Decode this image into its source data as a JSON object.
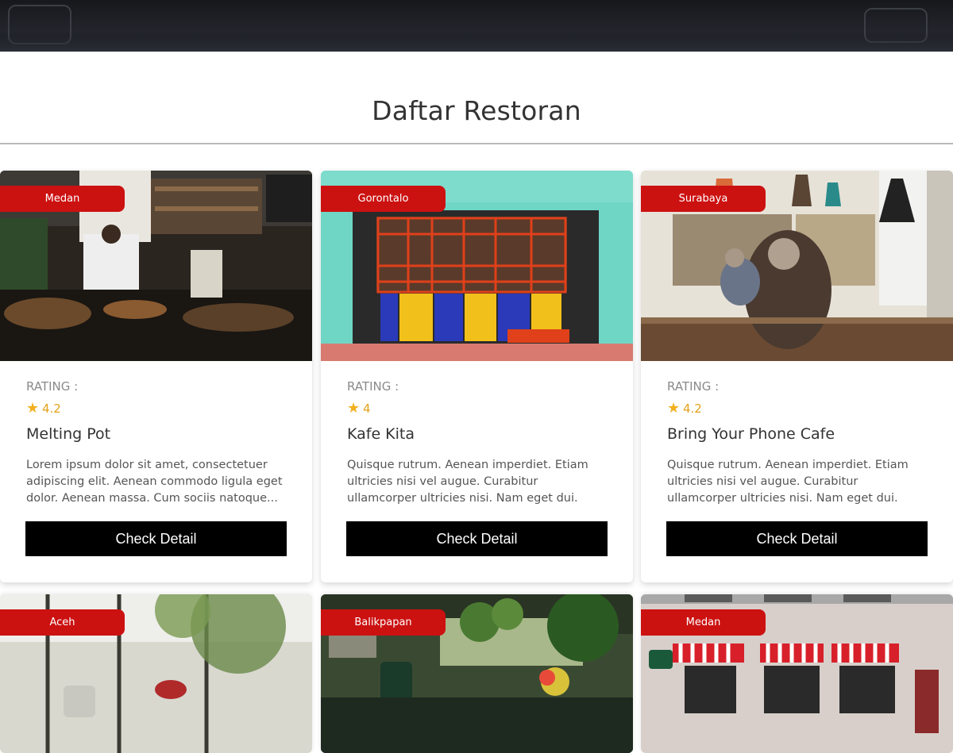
{
  "section": {
    "title": "Daftar Restoran"
  },
  "restaurants": [
    {
      "city": "Medan",
      "rating_label": "RATING :",
      "rating": "4.2",
      "name": "Melting Pot",
      "description": "Lorem ipsum dolor sit amet, consectetuer adipiscing elit. Aenean commodo ligula eget dolor. Aenean massa. Cum sociis natoque...",
      "button": "Check Detail"
    },
    {
      "city": "Gorontalo",
      "rating_label": "RATING :",
      "rating": "4",
      "name": "Kafe Kita",
      "description": "Quisque rutrum. Aenean imperdiet. Etiam ultricies nisi vel augue. Curabitur ullamcorper ultricies nisi. Nam eget dui. Etiam rhoncus....",
      "button": "Check Detail"
    },
    {
      "city": "Surabaya",
      "rating_label": "RATING :",
      "rating": "4.2",
      "name": "Bring Your Phone Cafe",
      "description": "Quisque rutrum. Aenean imperdiet. Etiam ultricies nisi vel augue. Curabitur ullamcorper ultricies nisi. Nam eget dui. Etiam rhoncus....",
      "button": "Check Detail"
    },
    {
      "city": "Aceh"
    },
    {
      "city": "Balikpapan"
    },
    {
      "city": "Medan"
    }
  ],
  "colors": {
    "badge": "#cc1111",
    "star": "#f2b01e",
    "button": "#000000"
  },
  "icons": {
    "rating": "star-icon"
  }
}
